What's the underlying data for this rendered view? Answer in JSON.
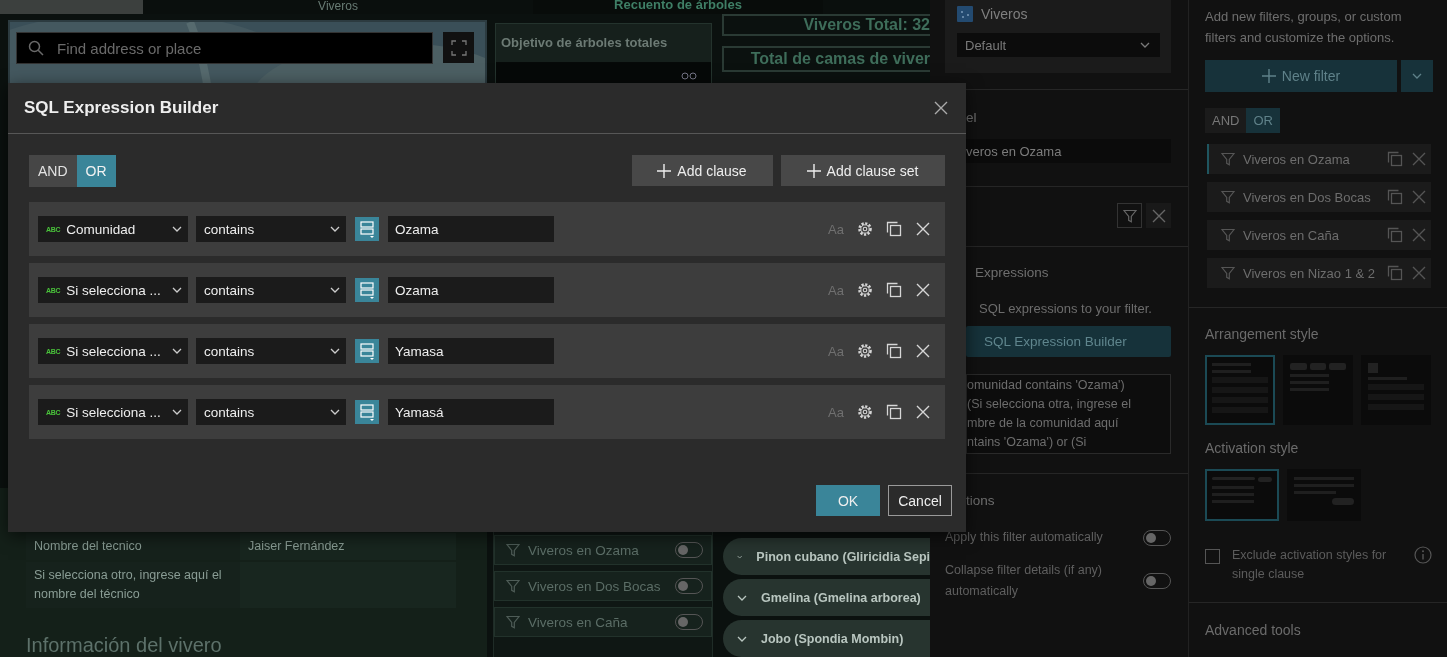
{
  "dashboard": {
    "header_tabs": [
      {
        "label": "Viveros"
      },
      {
        "label": "Recuento de árboles"
      }
    ],
    "map": {
      "search_placeholder": "Find address or place"
    },
    "target_card": {
      "title": "Objetivo de árboles totales"
    },
    "totals": [
      "Viveros Total: 32",
      "Total de camas de viver"
    ],
    "technician_rows": [
      {
        "label": "Nombre del tecnico",
        "value": "Jaiser Fernández"
      },
      {
        "label": "Si selecciona otro, ingrese aquí el nombre del técnico"
      }
    ],
    "section_title": "Información del vivero",
    "filter_list": [
      {
        "label": "Viveros en Ozama",
        "on": false
      },
      {
        "label": "Viveros en Dos Bocas",
        "on": false
      },
      {
        "label": "Viveros en Caña",
        "on": false
      }
    ],
    "species": [
      {
        "label": "Pinon cubano (Gliricidia Sepi",
        "expanded": false
      },
      {
        "label": "Gmelina (Gmelina arborea)",
        "expanded": false
      },
      {
        "label": "Jobo (Spondia Mombin)",
        "expanded": false
      }
    ]
  },
  "settings": {
    "layer": {
      "name": "Viveros",
      "view": "Default"
    },
    "label_heading": "el",
    "label_value": "veros en Ozama",
    "expressions_heading": "Expressions",
    "expressions_hint": "SQL expressions to your filter.",
    "builder_button": "SQL Expression Builder",
    "expression_lines": [
      "omunidad contains 'Ozama')",
      "(Si selecciona otra, ingrese el",
      "mbre de la comunidad aquí",
      "ntains 'Ozama') or (Si"
    ],
    "options_heading": "tions",
    "options": [
      {
        "label": "Apply this filter automatically",
        "on": false
      },
      {
        "label": "Collapse filter details (if any) automatically",
        "on": false
      }
    ]
  },
  "filters_panel": {
    "description": "Add new filters, groups, or custom filters and customize the options.",
    "new_filter": "New filter",
    "logic": [
      {
        "label": "AND",
        "selected": false
      },
      {
        "label": "OR",
        "selected": true
      }
    ],
    "filters": [
      {
        "label": "Viveros en Ozama",
        "selected": true
      },
      {
        "label": "Viveros en Dos Bocas",
        "selected": false
      },
      {
        "label": "Viveros en Caña",
        "selected": false
      },
      {
        "label": "Viveros en Nizao 1 & 2",
        "selected": false
      }
    ],
    "arrangement_heading": "Arrangement style",
    "arrangement_styles": [
      {
        "kind": "list",
        "selected": true
      },
      {
        "kind": "tabs",
        "selected": false
      },
      {
        "kind": "sidebar",
        "selected": false
      }
    ],
    "activation_heading": "Activation style",
    "activation_styles": [
      {
        "kind": "toggle",
        "selected": true
      },
      {
        "kind": "button",
        "selected": false
      }
    ],
    "exclude_single": {
      "label": "Exclude activation styles for single clause",
      "checked": false
    },
    "advanced_heading": "Advanced tools"
  },
  "dialog": {
    "title": "SQL Expression Builder",
    "logic": [
      {
        "label": "AND",
        "selected": false
      },
      {
        "label": "OR",
        "selected": true
      }
    ],
    "actions": [
      "Add clause",
      "Add clause set"
    ],
    "clauses": [
      {
        "type_label": "ABC",
        "field": "Comunidad",
        "operator": "contains",
        "value": "Ozama",
        "case_label": "Aa"
      },
      {
        "type_label": "ABC",
        "field": "Si selecciona ...",
        "operator": "contains",
        "value": "Ozama",
        "case_label": "Aa"
      },
      {
        "type_label": "ABC",
        "field": "Si selecciona ...",
        "operator": "contains",
        "value": "Yamasa",
        "case_label": "Aa"
      },
      {
        "type_label": "ABC",
        "field": "Si selecciona ...",
        "operator": "contains",
        "value": "Yamasá",
        "case_label": "Aa"
      }
    ],
    "buttons": [
      "OK",
      "Cancel"
    ]
  }
}
